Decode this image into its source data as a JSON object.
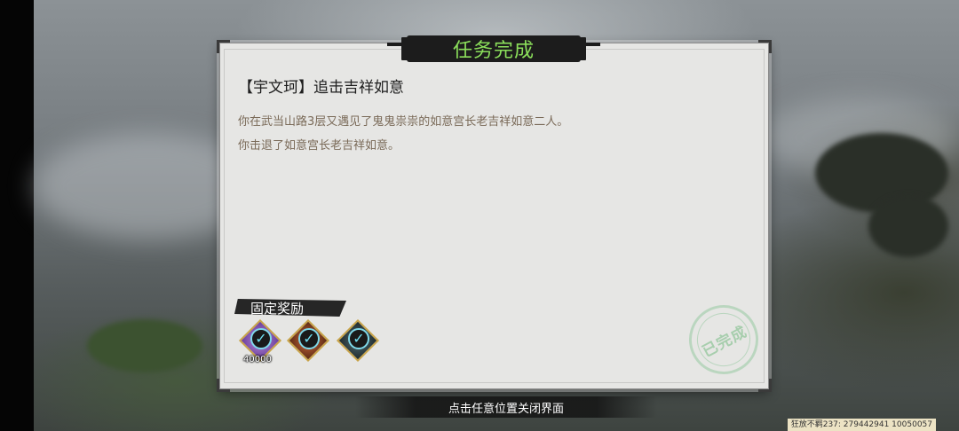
{
  "dialog": {
    "title": "任务完成",
    "quest_title": "【宇文珂】追击吉祥如意",
    "description_lines": [
      "你在武当山路3层又遇见了鬼鬼祟祟的如意宫长老吉祥如意二人。",
      "你击退了如意宫长老吉祥如意。"
    ],
    "reward_section_label": "固定奖励",
    "rewards": [
      {
        "icon": "purple-diamond-reward-icon",
        "count": "40000",
        "claimed": true
      },
      {
        "icon": "red-item-reward-icon",
        "count": "",
        "claimed": true
      },
      {
        "icon": "book-reward-icon",
        "count": "",
        "claimed": true
      }
    ],
    "stamp_text": "已完成"
  },
  "footer": {
    "close_hint": "点击任意位置关闭界面",
    "player_info": "狂放不羁237: 279442941  10050057"
  },
  "colors": {
    "title_green": "#8bdf5b",
    "check_cyan": "#6fe0f2",
    "stamp_green": "#8cc396"
  }
}
